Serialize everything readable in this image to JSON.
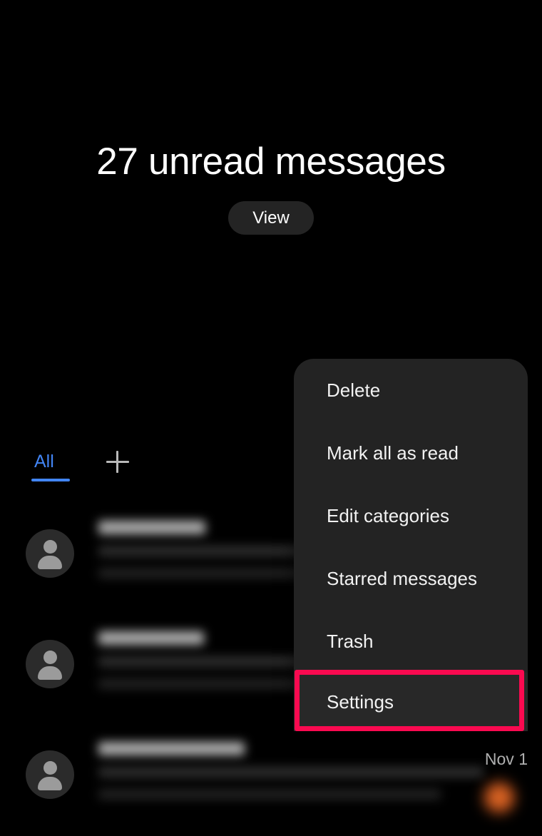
{
  "app": {
    "background_color": "#000000",
    "surface_color": "#232323"
  },
  "banner": {
    "unread_count": "27",
    "title": "27 unread messages",
    "view_label": "View"
  },
  "tabs": {
    "items": [
      {
        "label": "All",
        "active": true
      }
    ],
    "active_color": "#4285f4",
    "add_icon": "plus-icon"
  },
  "messages": {
    "rows": [
      {
        "sender": "",
        "preview": "",
        "date": ""
      },
      {
        "sender": "",
        "preview": "",
        "date": ""
      },
      {
        "sender": "",
        "preview": "",
        "date": "Nov 1"
      }
    ]
  },
  "menu": {
    "items": [
      {
        "label": "Delete",
        "highlighted": false
      },
      {
        "label": "Mark all as read",
        "highlighted": false
      },
      {
        "label": "Edit categories",
        "highlighted": false
      },
      {
        "label": "Starred messages",
        "highlighted": false
      },
      {
        "label": "Trash",
        "highlighted": false
      },
      {
        "label": "Settings",
        "highlighted": true
      }
    ],
    "highlight_color": "#fa0a50"
  }
}
